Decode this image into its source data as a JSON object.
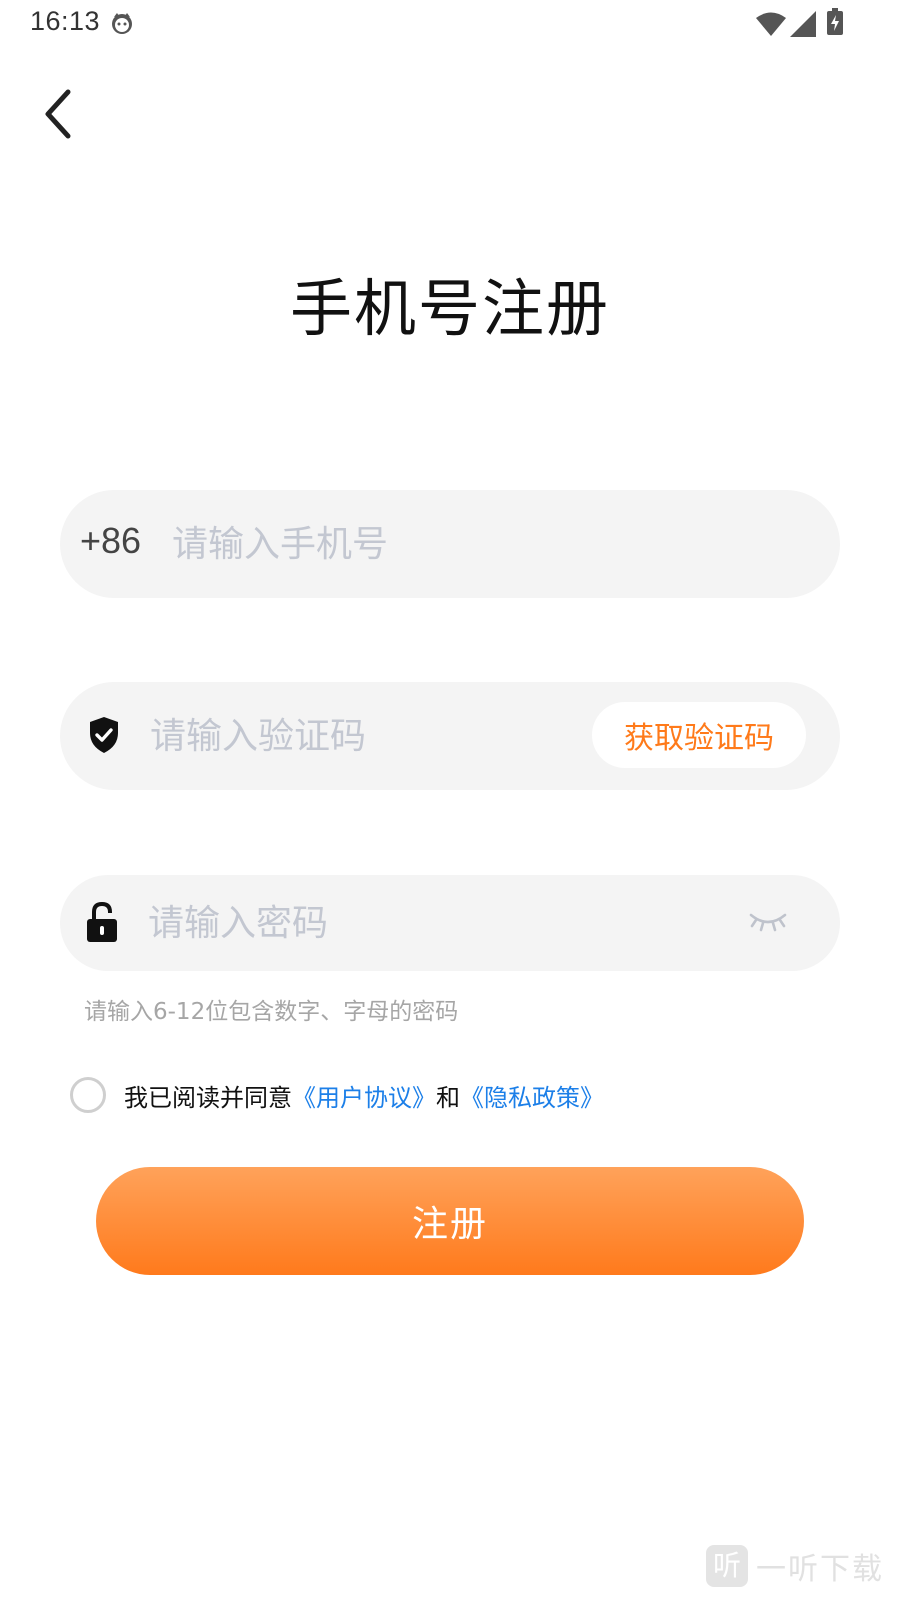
{
  "status_bar": {
    "time": "16:13",
    "icons": [
      "face-icon",
      "wifi-icon",
      "signal-icon",
      "battery-charging-icon"
    ]
  },
  "header": {
    "back_icon": "chevron-left-icon"
  },
  "title": "手机号注册",
  "phone": {
    "prefix": "+86",
    "placeholder": "请输入手机号",
    "value": ""
  },
  "code": {
    "icon": "shield-check-icon",
    "placeholder": "请输入验证码",
    "value": "",
    "get_code_label": "获取验证码"
  },
  "password": {
    "icon": "lock-open-icon",
    "placeholder": "请输入密码",
    "value": "",
    "toggle_icon": "eye-closed-icon",
    "hint": "请输入6-12位包含数字、字母的密码"
  },
  "agreement": {
    "checked": false,
    "prefix": "我已阅读并同意",
    "user_agreement": "《用户协议》",
    "conjunction": "和",
    "privacy_policy": "《隐私政策》"
  },
  "register_label": "注册",
  "watermark": {
    "logo_char": "听",
    "text": "一听下载"
  },
  "colors": {
    "accent": "#ff7a1a",
    "link": "#1c7fe8",
    "field_bg": "#f4f4f4",
    "placeholder": "#c3c7d1"
  }
}
